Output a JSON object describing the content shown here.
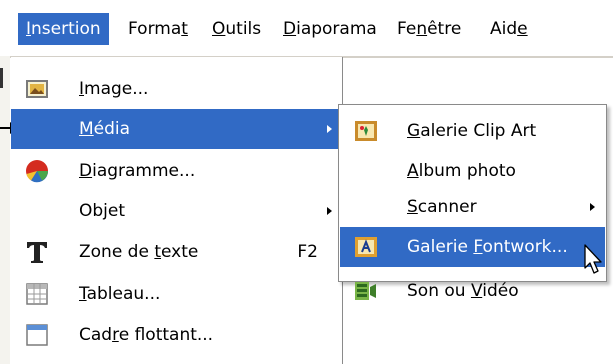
{
  "menubar": {
    "items": [
      {
        "label": "Insertion",
        "mnemonic": "I",
        "rest": "nsertion",
        "active": true
      },
      {
        "label": "Format",
        "pre": "Forma",
        "mnemonic": "t",
        "post": ""
      },
      {
        "label": "Outils",
        "pre": "",
        "mnemonic": "O",
        "post": "utils"
      },
      {
        "label": "Diaporama",
        "pre": "",
        "mnemonic": "D",
        "post": "iaporama"
      },
      {
        "label": "Fenêtre",
        "pre": "Fe",
        "mnemonic": "n",
        "post": "être"
      },
      {
        "label": "Aide",
        "pre": "Aid",
        "mnemonic": "e",
        "post": ""
      }
    ]
  },
  "menu": {
    "items": [
      {
        "label": "Image...",
        "pre": "",
        "mnemonic": "I",
        "post": "mage...",
        "icon": "image-icon"
      },
      {
        "label": "Média",
        "pre": "",
        "mnemonic": "M",
        "post": "édia",
        "submenu": true,
        "highlighted": true
      },
      {
        "label": "Diagramme...",
        "pre": "",
        "mnemonic": "D",
        "post": "iagramme...",
        "icon": "chart-icon"
      },
      {
        "label": "Objet",
        "pre": "",
        "mnemonic": "",
        "post": "Objet",
        "submenu": true
      },
      {
        "label": "Zone de texte",
        "pre": "Zone de ",
        "mnemonic": "t",
        "post": "exte",
        "shortcut": "F2",
        "icon": "text-icon"
      },
      {
        "label": "Tableau...",
        "pre": "",
        "mnemonic": "T",
        "post": "ableau...",
        "icon": "table-icon"
      },
      {
        "label": "Cadre flottant...",
        "pre": "Cad",
        "mnemonic": "r",
        "post": "e flottant...",
        "icon": "frame-icon"
      }
    ]
  },
  "submenu": {
    "items": [
      {
        "label": "Galerie Clip Art",
        "pre": "",
        "mnemonic": "G",
        "post": "alerie Clip Art",
        "icon": "gallery-icon"
      },
      {
        "label": "Album photo",
        "pre": "",
        "mnemonic": "A",
        "post": "lbum photo"
      },
      {
        "label": "Scanner",
        "pre": "",
        "mnemonic": "S",
        "post": "canner",
        "submenu": true
      },
      {
        "label": "Galerie Fontwork...",
        "pre": "Galerie ",
        "mnemonic": "F",
        "post": "ontwork...",
        "icon": "fontwork-icon",
        "highlighted": true
      },
      {
        "label": "Son ou Vidéo",
        "pre": "Son ou ",
        "mnemonic": "V",
        "post": "idéo",
        "icon": "sound-video-icon"
      }
    ]
  }
}
